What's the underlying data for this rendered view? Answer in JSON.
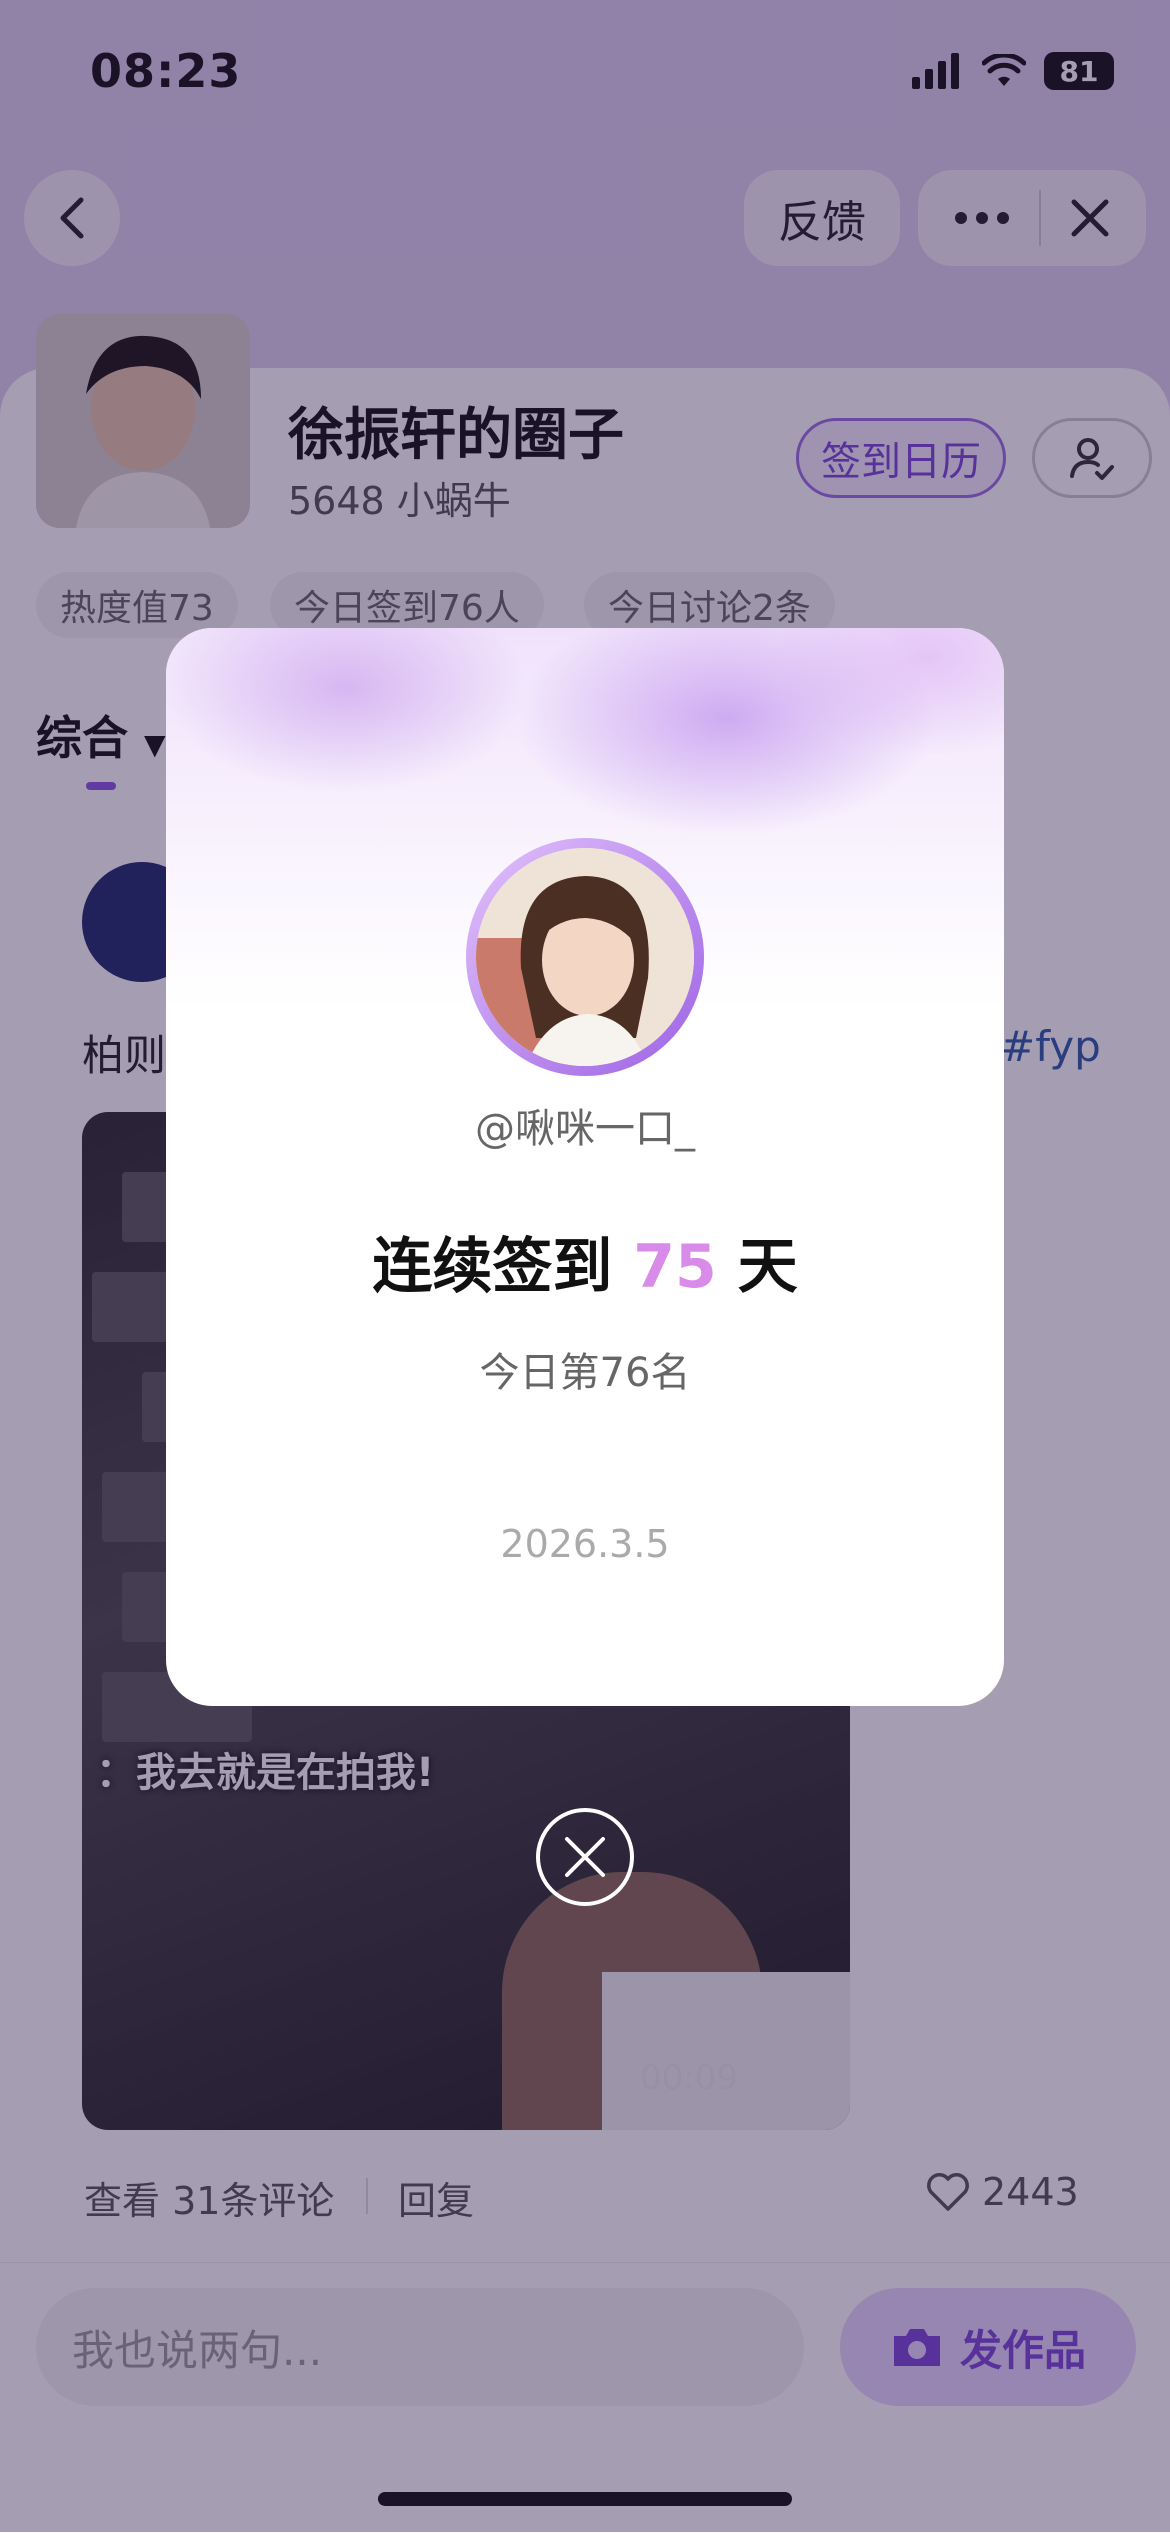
{
  "status_bar": {
    "time": "08:23",
    "battery": "81"
  },
  "nav": {
    "feedback_label": "反馈"
  },
  "circle": {
    "title": "徐振轩的圈子",
    "subtitle": "5648 小蜗牛",
    "calendar_label": "签到日历"
  },
  "chips": [
    "热度值73",
    "今日签到76人",
    "今日讨论2条"
  ],
  "tabs": {
    "main": "综合"
  },
  "post": {
    "text": "柏则",
    "tag": "#fyp",
    "video_caption": "：我去就是在拍我!",
    "video_time": "00:09",
    "comments_label": "查看 31条评论",
    "reply_label": "回复",
    "likes": "2443"
  },
  "bottom": {
    "input_placeholder": "我也说两句...",
    "post_button_label": "发作品"
  },
  "modal": {
    "handle": "@啾咪一口_",
    "streak_prefix": "连续签到",
    "streak_days": "75",
    "streak_suffix": "天",
    "rank": "今日第76名",
    "date": "2026.3.5"
  },
  "colors": {
    "accent": "#8a56e6",
    "streak_number": "#d88be8",
    "tag_link": "#2c5aa8"
  }
}
